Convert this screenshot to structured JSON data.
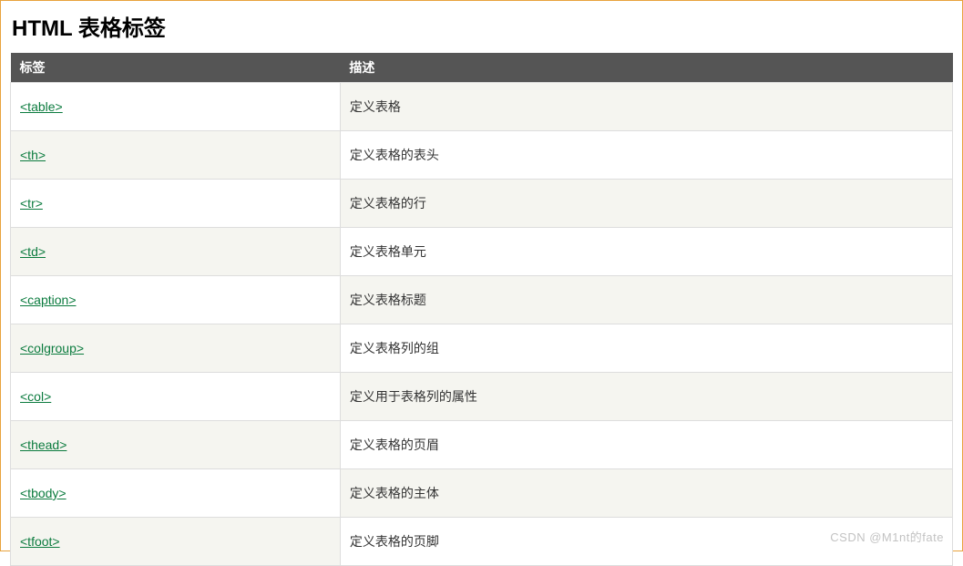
{
  "heading": "HTML 表格标签",
  "columns": {
    "tag": "标签",
    "desc": "描述"
  },
  "rows": [
    {
      "tag": "<table>",
      "desc": "定义表格"
    },
    {
      "tag": "<th>",
      "desc": "定义表格的表头"
    },
    {
      "tag": "<tr>",
      "desc": "定义表格的行"
    },
    {
      "tag": "<td>",
      "desc": "定义表格单元"
    },
    {
      "tag": "<caption>",
      "desc": "定义表格标题"
    },
    {
      "tag": "<colgroup>",
      "desc": "定义表格列的组"
    },
    {
      "tag": "<col>",
      "desc": "定义用于表格列的属性"
    },
    {
      "tag": "<thead>",
      "desc": "定义表格的页眉"
    },
    {
      "tag": "<tbody>",
      "desc": "定义表格的主体"
    },
    {
      "tag": "<tfoot>",
      "desc": "定义表格的页脚"
    }
  ],
  "watermark": "CSDN @M1nt的fate"
}
